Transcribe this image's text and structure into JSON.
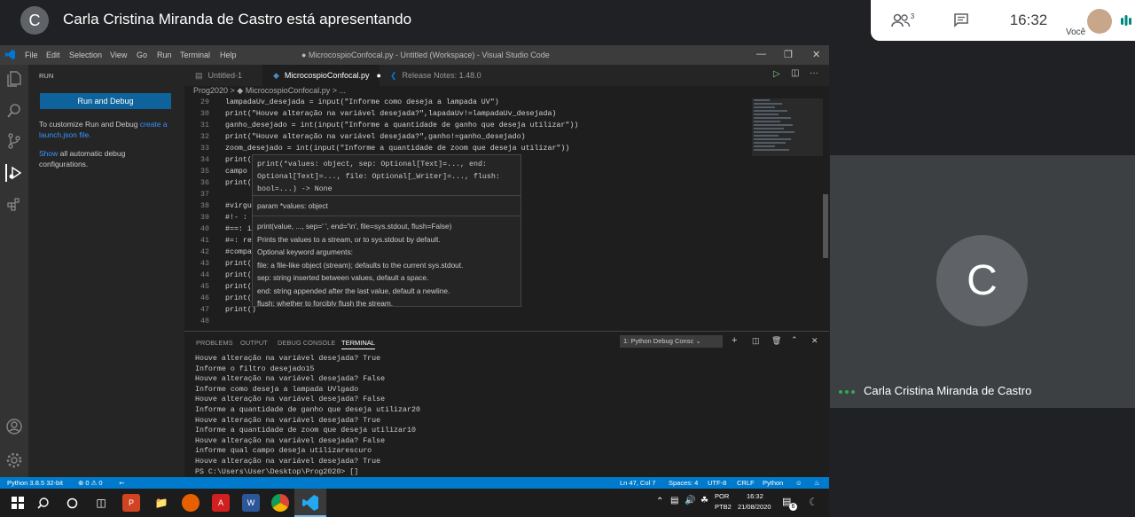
{
  "meet": {
    "avatar_letter": "C",
    "presenting_title": "Carla Cristina Miranda de Castro está apresentando",
    "participants_count": "3",
    "clock": "16:32",
    "self_label": "Você",
    "tile_letter": "C",
    "tile_name": "Carla Cristina Miranda de Castro"
  },
  "vscode": {
    "menu": [
      "File",
      "Edit",
      "Selection",
      "View",
      "Go",
      "Run",
      "Terminal",
      "Help"
    ],
    "window_title": "● MicrocospioConfocal.py - Untitled (Workspace) - Visual Studio Code",
    "sidebar": {
      "header": "RUN",
      "run_button": "Run and Debug",
      "customize_text": "To customize Run and Debug",
      "customize_link": "create a launch.json file.",
      "show_link": "Show",
      "show_text": "all automatic debug configurations."
    },
    "tabs": [
      {
        "label": "Untitled-1"
      },
      {
        "label": "MicrocospioConfocal.py"
      },
      {
        "label": "Release Notes: 1.48.0"
      }
    ],
    "breadcrumb": "Prog2020 > ◆ MicrocospioConfocal.py > ...",
    "lines": [
      {
        "n": "29",
        "t": "lampadaUv_desejada = input(\"Informe como deseja a lampada UV\")"
      },
      {
        "n": "30",
        "t": "print(\"Houve alteração na variável desejada?\",lapadaUv!=lampadaUv_desejada)"
      },
      {
        "n": "31",
        "t": "ganho_desejado = int(input(\"Informe a quantidade de ganho que deseja utilizar\"))"
      },
      {
        "n": "32",
        "t": "print(\"Houve alteração na variável desejada?\",ganho!=ganho_desejado)"
      },
      {
        "n": "33",
        "t": "zoom_desejado = int(input(\"Informe a quantidade de zoom que deseja utilizar\"))"
      },
      {
        "n": "34",
        "t": "print(                                                  do)"
      },
      {
        "n": "35",
        "t": "campo"
      },
      {
        "n": "36",
        "t": "print(                                                  jado)"
      },
      {
        "n": "37",
        "t": ""
      },
      {
        "n": "38",
        "t": "#virgu"
      },
      {
        "n": "39",
        "t": "#!- :"
      },
      {
        "n": "40",
        "t": "#==: i"
      },
      {
        "n": "41",
        "t": "#=: re"
      },
      {
        "n": "42",
        "t": "#compa"
      },
      {
        "n": "43",
        "t": "print(                                                       o:\")"
      },
      {
        "n": "44",
        "t": "print("
      },
      {
        "n": "45",
        "t": "print("
      },
      {
        "n": "46",
        "t": "print("
      },
      {
        "n": "47",
        "t": "print()"
      },
      {
        "n": "48",
        "t": ""
      }
    ],
    "hover": {
      "signature": "print(*values: object, sep: Optional[Text]=..., end: Optional[Text]=..., file: Optional[_Writer]=..., flush: bool=...) -> None",
      "param": "param *values: object",
      "doc_lines": [
        "print(value, ..., sep=' ', end='\\n', file=sys.stdout, flush=False)",
        "Prints the values to a stream, or to sys.stdout by default.",
        "Optional keyword arguments:",
        "file:  a file-like object (stream); defaults to the current sys.stdout.",
        "sep:   string inserted between values, default a space.",
        "end:   string appended after the last value, default a newline.",
        "flush: whether to forcibly flush the stream."
      ]
    },
    "panel_tabs": [
      "PROBLEMS",
      "OUTPUT",
      "DEBUG CONSOLE",
      "TERMINAL"
    ],
    "terminal_select": "1: Python Debug Consc",
    "terminal_lines": [
      "Houve alteração na variável desejada? True",
      "Informe o filtro desejado15",
      "Houve alteração na variável desejada? False",
      "Informe como deseja a lampada UVlgado",
      "Houve alteração na variável desejada? False",
      "Informe a quantidade de ganho que deseja utilizar20",
      "Houve alteração na variável desejada? True",
      "Informe a quantidade de zoom que deseja utilizar10",
      "Houve alteração na variável desejada? False",
      "informe qual campo deseja utilizarescuro",
      "Houve alteração na variável desejada? True",
      "PS C:\\Users\\User\\Desktop\\Prog2020> []"
    ],
    "status": {
      "python": "Python 3.8.5 32-bit",
      "problems": "⊗ 0 ⚠ 0",
      "position": "Ln 47, Col 7",
      "spaces": "Spaces: 4",
      "encoding": "UTF-8",
      "eol": "CRLF",
      "lang": "Python"
    }
  },
  "taskbar": {
    "lang1": "POR",
    "lang2": "PTB2",
    "time": "16:32",
    "date": "21/08/2020",
    "notif_count": "6"
  }
}
